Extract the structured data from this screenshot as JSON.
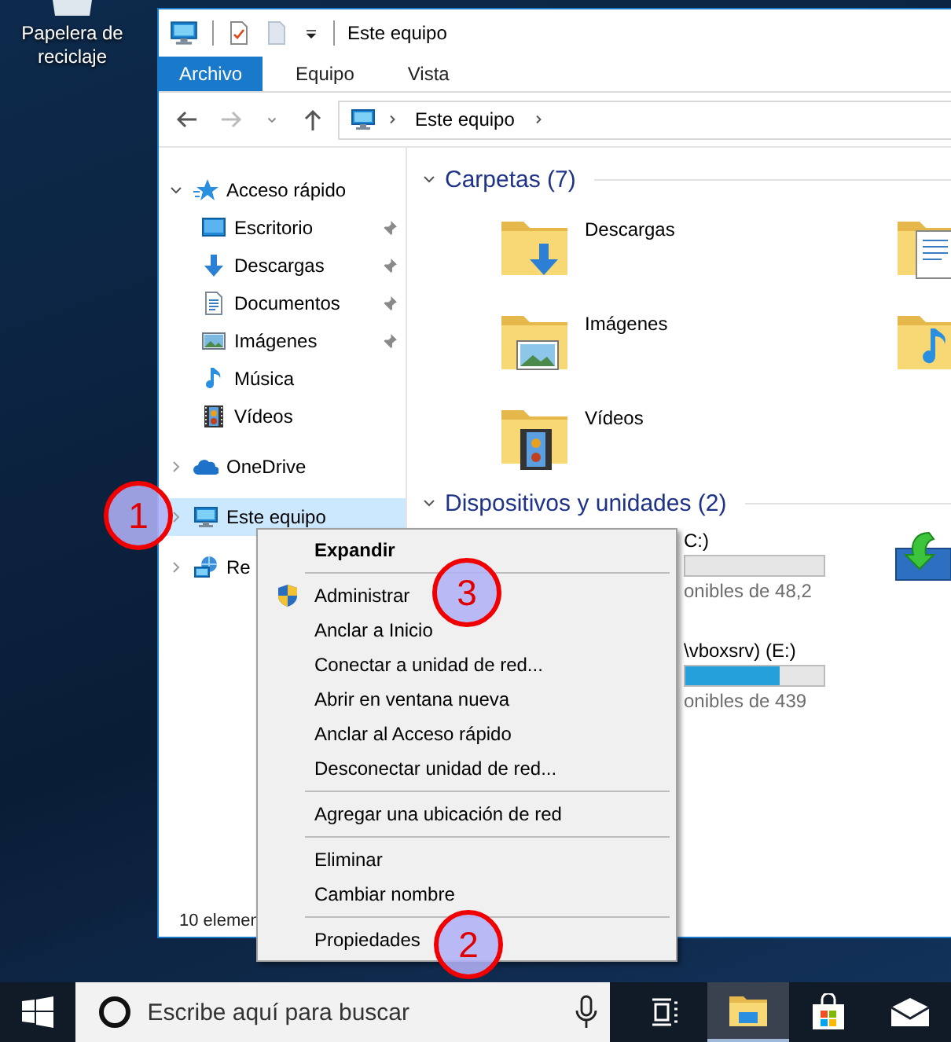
{
  "desktop_icons": [
    {
      "label": "Papelera de reciclaje"
    }
  ],
  "explorer": {
    "title": "Este equipo",
    "ribbon_tabs": [
      {
        "label": "Archivo",
        "selected": true
      },
      {
        "label": "Equipo",
        "selected": false
      },
      {
        "label": "Vista",
        "selected": false
      }
    ],
    "address": [
      "Este equipo"
    ],
    "nav": [
      {
        "label": "Acceso rápido",
        "kind": "star",
        "expanded": true,
        "selected": false,
        "children": [
          {
            "label": "Escritorio",
            "kind": "desktop",
            "pinned": true,
            "selected": false
          },
          {
            "label": "Descargas",
            "kind": "download",
            "pinned": true,
            "selected": false
          },
          {
            "label": "Documentos",
            "kind": "document",
            "pinned": true,
            "selected": false
          },
          {
            "label": "Imágenes",
            "kind": "pictures",
            "pinned": true,
            "selected": false
          },
          {
            "label": "Música",
            "kind": "music",
            "pinned": false,
            "selected": false
          },
          {
            "label": "Vídeos",
            "kind": "videos",
            "pinned": false,
            "selected": false
          }
        ]
      },
      {
        "label": "OneDrive",
        "kind": "cloud",
        "expanded": false,
        "selected": false
      },
      {
        "label": "Este equipo",
        "kind": "pc",
        "expanded": false,
        "selected": true
      },
      {
        "label": "Re",
        "kind": "network",
        "expanded": false,
        "selected": false
      }
    ],
    "sections": [
      {
        "title": "Carpetas (7)",
        "expanded": true,
        "items": [
          {
            "kind": "download",
            "label": "Descargas"
          },
          {
            "kind": "documents"
          },
          {
            "kind": "pictures",
            "label": "Imágenes"
          },
          {
            "kind": "music"
          },
          {
            "kind": "videos",
            "label": "Vídeos"
          }
        ]
      },
      {
        "title": "Dispositivos y unidades (2)",
        "expanded": true,
        "items": [
          {
            "kind": "disk",
            "label": "C:)",
            "level": 0,
            "detail": "onibles de 48,2"
          },
          {
            "kind": "dvd"
          },
          {
            "kind": "disk",
            "label": "\\vboxsrv) (E:)",
            "level": 0.68,
            "detail": "onibles de 439"
          }
        ]
      }
    ],
    "status": "10 elemen"
  },
  "context_menu": [
    {
      "kind": "default",
      "label": "Expandir"
    },
    {
      "kind": "separator"
    },
    {
      "kind": "shield",
      "label": "Administrar"
    },
    {
      "kind": "item",
      "label": "Anclar a Inicio"
    },
    {
      "kind": "item",
      "label": "Conectar a unidad de red..."
    },
    {
      "kind": "item",
      "label": "Abrir en ventana nueva"
    },
    {
      "kind": "item",
      "label": "Anclar al Acceso rápido"
    },
    {
      "kind": "item",
      "label": "Desconectar unidad de red..."
    },
    {
      "kind": "separator"
    },
    {
      "kind": "item",
      "label": "Agregar una ubicación de red"
    },
    {
      "kind": "separator"
    },
    {
      "kind": "item",
      "label": "Eliminar"
    },
    {
      "kind": "item",
      "label": "Cambiar nombre"
    },
    {
      "kind": "separator"
    },
    {
      "kind": "item",
      "label": "Propiedades"
    }
  ],
  "annotations": [
    {
      "label": "1"
    },
    {
      "label": "3"
    },
    {
      "label": "2"
    }
  ],
  "taskbar": {
    "search": {
      "placeholder": "Escribe aquí para buscar"
    },
    "apps": [
      {
        "kind": "taskview",
        "active": false
      },
      {
        "kind": "explorer",
        "active": true
      },
      {
        "kind": "store",
        "active": false
      },
      {
        "kind": "mail",
        "active": false
      }
    ]
  }
}
